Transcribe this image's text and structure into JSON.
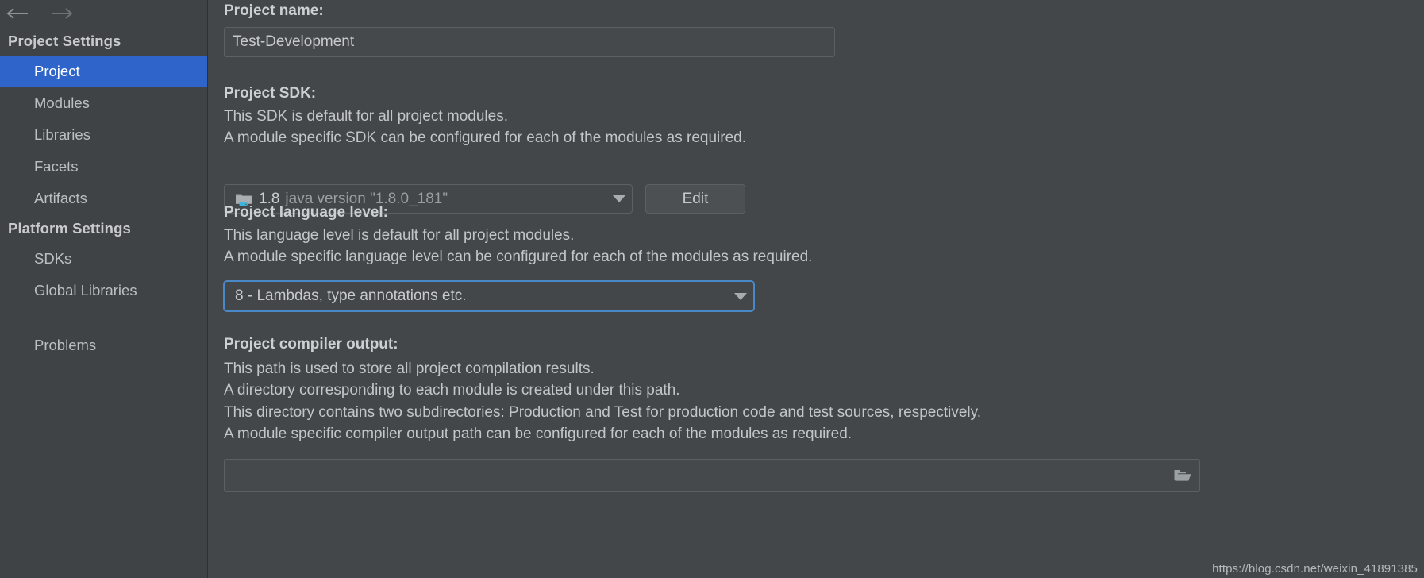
{
  "sidebar": {
    "nav": {
      "back_icon": "arrow-left-icon",
      "forward_icon": "arrow-right-icon"
    },
    "groups": [
      {
        "header": "Project Settings",
        "items": [
          {
            "label": "Project",
            "selected": true
          },
          {
            "label": "Modules",
            "selected": false
          },
          {
            "label": "Libraries",
            "selected": false
          },
          {
            "label": "Facets",
            "selected": false
          },
          {
            "label": "Artifacts",
            "selected": false
          }
        ]
      },
      {
        "header": "Platform Settings",
        "items": [
          {
            "label": "SDKs",
            "selected": false
          },
          {
            "label": "Global Libraries",
            "selected": false
          }
        ]
      }
    ],
    "footer_items": [
      {
        "label": "Problems",
        "selected": false
      }
    ]
  },
  "main": {
    "project_name": {
      "label": "Project name:",
      "value": "Test-Development",
      "placeholder": ""
    },
    "project_sdk": {
      "label": "Project SDK:",
      "desc_line1": "This SDK is default for all project modules.",
      "desc_line2": "A module specific SDK can be configured for each of the modules as required.",
      "combo_name": "1.8",
      "combo_detail": "java version \"1.8.0_181\"",
      "combo_icon": "java-sdk-folder-icon",
      "edit_button": "Edit"
    },
    "language_level": {
      "label": "Project language level:",
      "desc_line1": "This language level is default for all project modules.",
      "desc_line2": "A module specific language level can be configured for each of the modules as required.",
      "value": "8 - Lambdas, type annotations etc."
    },
    "compiler_output": {
      "label": "Project compiler output:",
      "desc_line1": "This path is used to store all project compilation results.",
      "desc_line2": "A directory corresponding to each module is created under this path.",
      "desc_line3": "This directory contains two subdirectories: Production and Test for production code and test sources, respectively.",
      "desc_line4": "A module specific compiler output path can be configured for each of the modules as required.",
      "value": "",
      "placeholder": "",
      "browse_icon": "folder-open-icon"
    }
  },
  "watermark": {
    "text": "https://blog.csdn.net/weixin_41891385"
  },
  "colors": {
    "accent_selection": "#2f65ca",
    "focus_border": "#4a88c7",
    "panel_bg": "#43474a",
    "sidebar_bg": "#3f4346",
    "text_primary": "#c8cacc",
    "text_dim": "#9a9ea1"
  }
}
